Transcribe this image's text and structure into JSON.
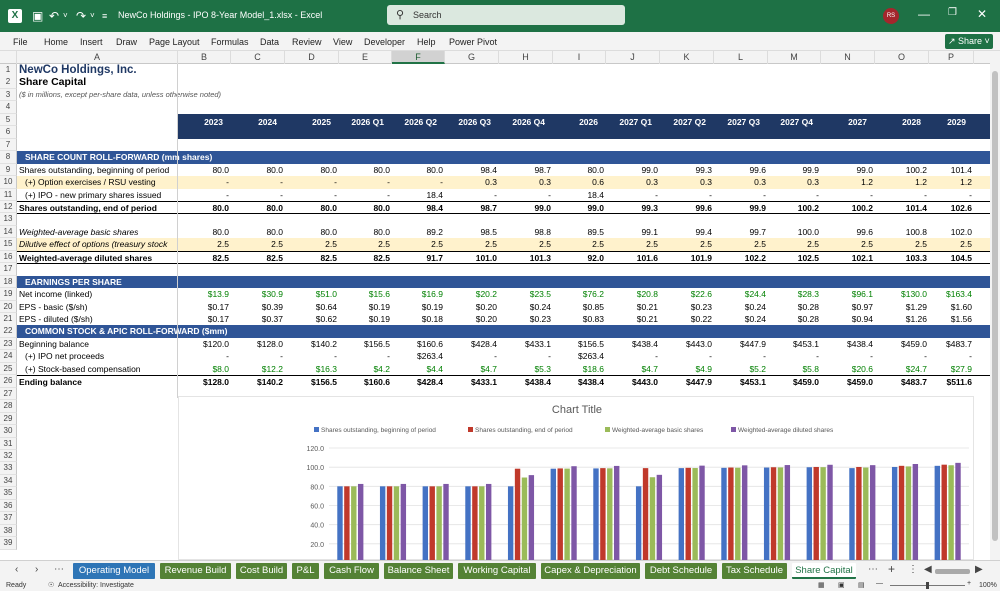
{
  "titlebar": {
    "doc_title": "NewCo Holdings - IPO 8-Year Model_1.xlsx  -  Excel",
    "search_placeholder": "Search",
    "avatar": "RS"
  },
  "menu": [
    "File",
    "Home",
    "Insert",
    "Draw",
    "Page Layout",
    "Formulas",
    "Data",
    "Review",
    "View",
    "Developer",
    "Help",
    "Power Pivot"
  ],
  "share_label": "Share",
  "columns": [
    "A",
    "B",
    "C",
    "D",
    "E",
    "F",
    "G",
    "H",
    "I",
    "J",
    "K",
    "L",
    "M",
    "N",
    "O",
    "P"
  ],
  "selected_column": "F",
  "rows": [
    "1",
    "2",
    "3",
    "4",
    "5",
    "6",
    "7",
    "8",
    "9",
    "10",
    "11",
    "12",
    "13",
    "14",
    "15",
    "16",
    "17",
    "18",
    "19",
    "20",
    "21",
    "22",
    "23",
    "24",
    "25",
    "26",
    "27",
    "28",
    "29",
    "30",
    "31",
    "32",
    "33",
    "34",
    "35",
    "36",
    "37",
    "38",
    "39"
  ],
  "sheet": {
    "company": "NewCo Holdings, Inc.",
    "subtitle": "Share Capital",
    "note": "($ in millions, except per-share data, unless otherwise noted)",
    "periods": [
      "2023",
      "2024",
      "2025",
      "2026 Q1",
      "2026 Q2",
      "2026 Q3",
      "2026 Q4",
      "2026",
      "2027 Q1",
      "2027 Q2",
      "2027 Q3",
      "2027 Q4",
      "2027",
      "2028",
      "2029"
    ],
    "sec1": "SHARE COUNT ROLL-FORWARD (mm shares)",
    "r9": {
      "label": "Shares outstanding, beginning of period",
      "vals": [
        "80.0",
        "80.0",
        "80.0",
        "80.0",
        "80.0",
        "98.4",
        "98.7",
        "80.0",
        "99.0",
        "99.3",
        "99.6",
        "99.9",
        "99.0",
        "100.2",
        "101.4"
      ]
    },
    "r10": {
      "label": "(+) Option exercises / RSU vesting",
      "vals": [
        "-",
        "-",
        "-",
        "-",
        "-",
        "0.3",
        "0.3",
        "0.6",
        "0.3",
        "0.3",
        "0.3",
        "0.3",
        "1.2",
        "1.2",
        "1.2"
      ]
    },
    "r11": {
      "label": "(+) IPO - new primary shares issued",
      "vals": [
        "-",
        "-",
        "-",
        "-",
        "18.4",
        "-",
        "-",
        "18.4",
        "-",
        "-",
        "-",
        "-",
        "-",
        "-",
        "-"
      ]
    },
    "r12": {
      "label": "Shares outstanding, end of period",
      "vals": [
        "80.0",
        "80.0",
        "80.0",
        "80.0",
        "98.4",
        "98.7",
        "99.0",
        "99.0",
        "99.3",
        "99.6",
        "99.9",
        "100.2",
        "100.2",
        "101.4",
        "102.6"
      ]
    },
    "r14": {
      "label": "Weighted-average basic shares",
      "vals": [
        "80.0",
        "80.0",
        "80.0",
        "80.0",
        "89.2",
        "98.5",
        "98.8",
        "89.5",
        "99.1",
        "99.4",
        "99.7",
        "100.0",
        "99.6",
        "100.8",
        "102.0"
      ]
    },
    "r15": {
      "label": "Dilutive effect of options (treasury stock",
      "vals": [
        "2.5",
        "2.5",
        "2.5",
        "2.5",
        "2.5",
        "2.5",
        "2.5",
        "2.5",
        "2.5",
        "2.5",
        "2.5",
        "2.5",
        "2.5",
        "2.5",
        "2.5"
      ]
    },
    "r16": {
      "label": "Weighted-average diluted shares",
      "vals": [
        "82.5",
        "82.5",
        "82.5",
        "82.5",
        "91.7",
        "101.0",
        "101.3",
        "92.0",
        "101.6",
        "101.9",
        "102.2",
        "102.5",
        "102.1",
        "103.3",
        "104.5"
      ]
    },
    "sec2": "EARNINGS PER SHARE",
    "r19": {
      "label": "Net income (linked)",
      "vals": [
        "$13.9",
        "$30.9",
        "$51.0",
        "$15.6",
        "$16.9",
        "$20.2",
        "$23.5",
        "$76.2",
        "$20.8",
        "$22.6",
        "$24.4",
        "$28.3",
        "$96.1",
        "$130.0",
        "$163.4"
      ]
    },
    "r20": {
      "label": "EPS - basic ($/sh)",
      "vals": [
        "$0.17",
        "$0.39",
        "$0.64",
        "$0.19",
        "$0.19",
        "$0.20",
        "$0.24",
        "$0.85",
        "$0.21",
        "$0.23",
        "$0.24",
        "$0.28",
        "$0.97",
        "$1.29",
        "$1.60"
      ]
    },
    "r21": {
      "label": "EPS - diluted ($/sh)",
      "vals": [
        "$0.17",
        "$0.37",
        "$0.62",
        "$0.19",
        "$0.18",
        "$0.20",
        "$0.23",
        "$0.83",
        "$0.21",
        "$0.22",
        "$0.24",
        "$0.28",
        "$0.94",
        "$1.26",
        "$1.56"
      ]
    },
    "sec3": "COMMON STOCK & APIC ROLL-FORWARD ($mm)",
    "r23": {
      "label": "Beginning balance",
      "vals": [
        "$120.0",
        "$128.0",
        "$140.2",
        "$156.5",
        "$160.6",
        "$428.4",
        "$433.1",
        "$156.5",
        "$438.4",
        "$443.0",
        "$447.9",
        "$453.1",
        "$438.4",
        "$459.0",
        "$483.7"
      ]
    },
    "r24": {
      "label": "(+) IPO net proceeds",
      "vals": [
        "-",
        "-",
        "-",
        "-",
        "$263.4",
        "-",
        "-",
        "$263.4",
        "-",
        "-",
        "-",
        "-",
        "-",
        "-",
        "-"
      ]
    },
    "r25": {
      "label": "(+) Stock-based compensation",
      "vals": [
        "$8.0",
        "$12.2",
        "$16.3",
        "$4.2",
        "$4.4",
        "$4.7",
        "$5.3",
        "$18.6",
        "$4.7",
        "$4.9",
        "$5.2",
        "$5.8",
        "$20.6",
        "$24.7",
        "$27.9"
      ]
    },
    "r26": {
      "label": "Ending balance",
      "vals": [
        "$128.0",
        "$140.2",
        "$156.5",
        "$160.6",
        "$428.4",
        "$433.1",
        "$438.4",
        "$438.4",
        "$443.0",
        "$447.9",
        "$453.1",
        "$459.0",
        "$459.0",
        "$483.7",
        "$511.6"
      ]
    }
  },
  "chart_data": {
    "type": "bar",
    "title": "Chart Title",
    "categories": [
      "2023",
      "2024",
      "2025",
      "2026 Q1",
      "2026 Q2",
      "2026 Q3",
      "2026 Q4",
      "2026",
      "2027 Q1",
      "2027 Q2",
      "2027 Q3",
      "2027 Q4",
      "2027",
      "2028",
      "2029"
    ],
    "series": [
      {
        "name": "Shares outstanding, beginning of period",
        "color": "#4472c4",
        "values": [
          80,
          80,
          80,
          80,
          80,
          98.4,
          98.7,
          80,
          99,
          99.3,
          99.6,
          99.9,
          99,
          100.2,
          101.4
        ]
      },
      {
        "name": "Shares outstanding, end of period",
        "color": "#c0392b",
        "values": [
          80,
          80,
          80,
          80,
          98.4,
          98.7,
          99,
          99,
          99.3,
          99.6,
          99.9,
          100.2,
          100.2,
          101.4,
          102.6
        ]
      },
      {
        "name": "Weighted-average basic shares",
        "color": "#9bbb59",
        "values": [
          80,
          80,
          80,
          80,
          89.2,
          98.5,
          98.8,
          89.5,
          99.1,
          99.4,
          99.7,
          100,
          99.6,
          100.8,
          102
        ]
      },
      {
        "name": "Weighted-average diluted shares",
        "color": "#7e57a6",
        "values": [
          82.5,
          82.5,
          82.5,
          82.5,
          91.7,
          101,
          101.3,
          92,
          101.6,
          101.9,
          102.2,
          102.5,
          102.1,
          103.3,
          104.5
        ]
      }
    ],
    "yticks": [
      "120.0",
      "100.0",
      "80.0",
      "60.0",
      "40.0",
      "20.0"
    ],
    "ylim": [
      0,
      120
    ],
    "legend": "top"
  },
  "tabs": [
    "Operating Model",
    "Revenue Build",
    "Cost Build",
    "P&L",
    "Cash Flow",
    "Balance Sheet",
    "Working Capital",
    "Capex & Depreciation",
    "Debt Schedule",
    "Tax Schedule",
    "Share Capital"
  ],
  "active_tab": "Share Capital",
  "status": {
    "ready": "Ready",
    "accessibility": "Accessibility: Investigate",
    "zoom": "100%"
  }
}
